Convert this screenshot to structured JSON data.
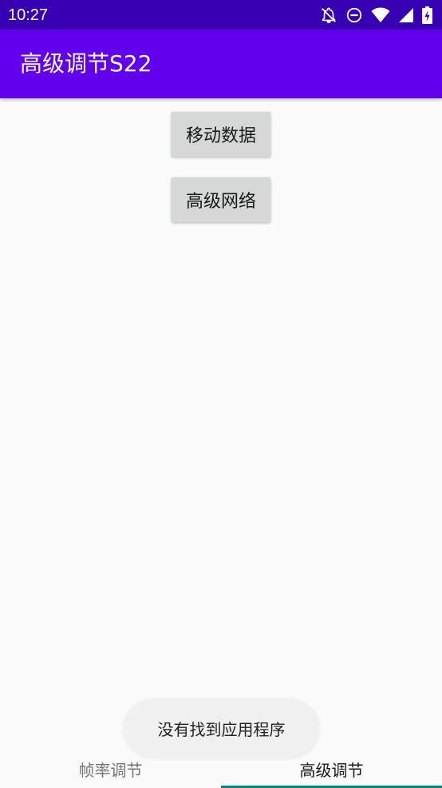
{
  "status_bar": {
    "time": "10:27",
    "icons": [
      "bell-off-icon",
      "do-not-disturb-icon",
      "wifi-icon",
      "signal-icon",
      "battery-charging-icon"
    ]
  },
  "app_bar": {
    "title": "高级调节S22"
  },
  "main": {
    "buttons": [
      {
        "label": "移动数据"
      },
      {
        "label": "高级网络"
      }
    ]
  },
  "toast": {
    "message": "没有找到应用程序"
  },
  "tabs": [
    {
      "label": "帧率调节",
      "selected": false
    },
    {
      "label": "高级调节",
      "selected": true
    }
  ],
  "colors": {
    "status_bar": "#3700b3",
    "app_bar": "#6200ee",
    "background": "#fafafa",
    "button": "#d6d7d7",
    "tab_indicator": "#018786"
  }
}
